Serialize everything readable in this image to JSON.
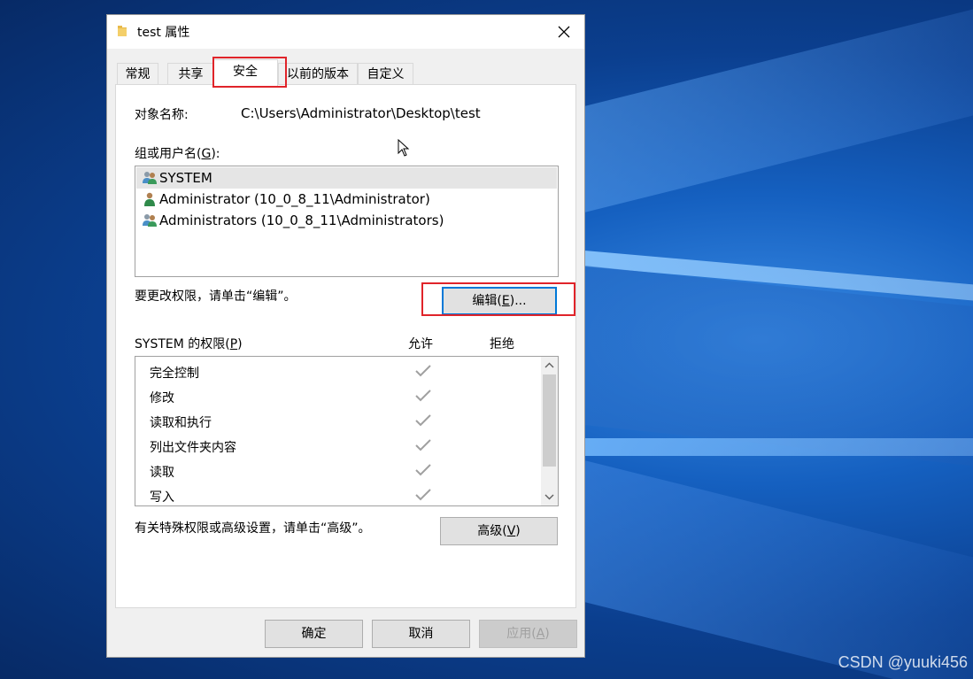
{
  "window": {
    "title": "test 属性",
    "close_icon": "close-icon",
    "folder_icon": "folder-icon"
  },
  "tabs": [
    {
      "label": "常规"
    },
    {
      "label": "共享"
    },
    {
      "label": "安全",
      "active": true
    },
    {
      "label": "以前的版本"
    },
    {
      "label": "自定义"
    }
  ],
  "object": {
    "label": "对象名称:",
    "value": "C:\\Users\\Administrator\\Desktop\\test"
  },
  "groups": {
    "label_prefix": "组或用户名(",
    "label_key": "G",
    "label_suffix": "):",
    "items": [
      {
        "name": "SYSTEM",
        "icon": "group-icon",
        "selected": true
      },
      {
        "name": "Administrator (10_0_8_11\\Administrator)",
        "icon": "user-icon"
      },
      {
        "name": "Administrators (10_0_8_11\\Administrators)",
        "icon": "group-icon"
      }
    ]
  },
  "edit": {
    "hint": "要更改权限，请单击“编辑”。",
    "button_prefix": "编辑(",
    "button_key": "E",
    "button_suffix": ")..."
  },
  "permissions": {
    "label_prefix": "SYSTEM 的权限(",
    "label_key": "P",
    "label_suffix": ")",
    "allow_header": "允许",
    "deny_header": "拒绝",
    "rows": [
      {
        "name": "完全控制",
        "allow": true,
        "deny": false
      },
      {
        "name": "修改",
        "allow": true,
        "deny": false
      },
      {
        "name": "读取和执行",
        "allow": true,
        "deny": false
      },
      {
        "name": "列出文件夹内容",
        "allow": true,
        "deny": false
      },
      {
        "name": "读取",
        "allow": true,
        "deny": false
      },
      {
        "name": "写入",
        "allow": true,
        "deny": false
      }
    ]
  },
  "advanced": {
    "hint": "有关特殊权限或高级设置，请单击“高级”。",
    "button_prefix": "高级(",
    "button_key": "V",
    "button_suffix": ")"
  },
  "footer": {
    "ok": "确定",
    "cancel": "取消",
    "apply_prefix": "应用(",
    "apply_key": "A",
    "apply_suffix": ")"
  },
  "watermark": "CSDN @yuuki456",
  "colors": {
    "highlight_border": "#e0242a",
    "focus_border": "#0078d7",
    "check_color": "#a0a0a0"
  }
}
